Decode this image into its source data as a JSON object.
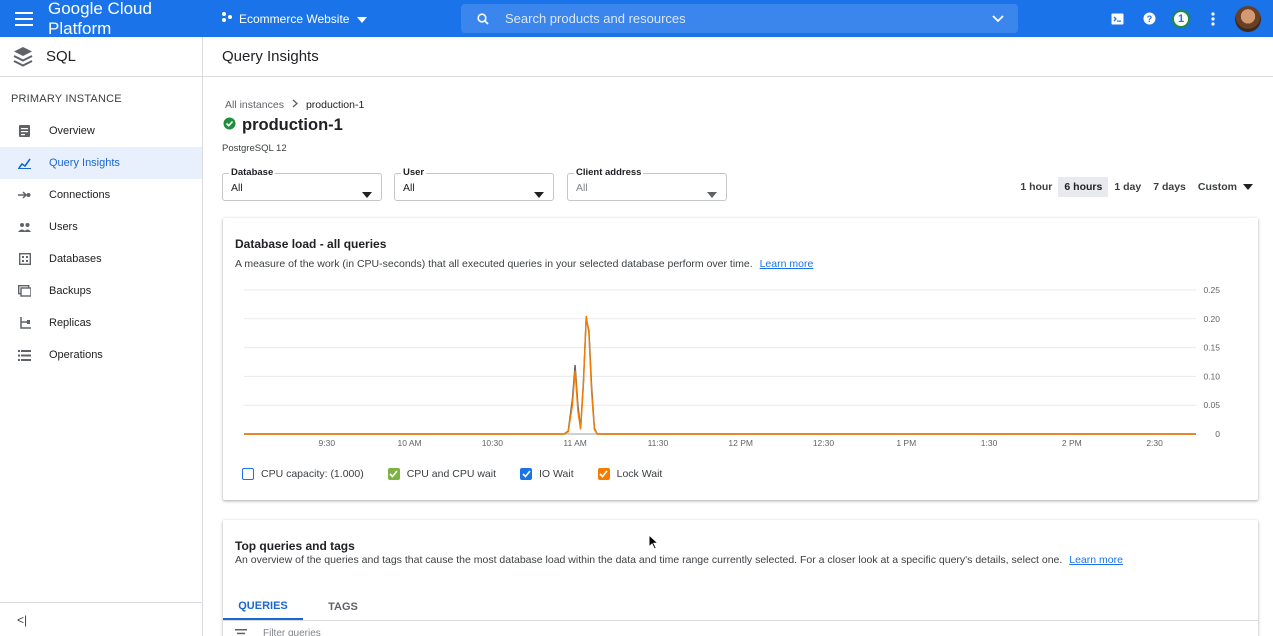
{
  "topbar": {
    "brand": "Google Cloud Platform",
    "project": "Ecommerce Website",
    "search_placeholder": "Search products and resources",
    "notification_count": "1",
    "color": "#1a73e8"
  },
  "sidebar": {
    "product": "SQL",
    "section": "PRIMARY INSTANCE",
    "items": [
      {
        "label": "Overview",
        "icon": "overview-icon"
      },
      {
        "label": "Query Insights",
        "icon": "query-insights-icon",
        "active": true
      },
      {
        "label": "Connections",
        "icon": "connections-icon"
      },
      {
        "label": "Users",
        "icon": "users-icon"
      },
      {
        "label": "Databases",
        "icon": "databases-icon"
      },
      {
        "label": "Backups",
        "icon": "backups-icon"
      },
      {
        "label": "Replicas",
        "icon": "replicas-icon"
      },
      {
        "label": "Operations",
        "icon": "operations-icon"
      }
    ],
    "collapse_label": "<|"
  },
  "main": {
    "page_title": "Query Insights",
    "breadcrumb": {
      "parent": "All instances",
      "current": "production-1"
    },
    "instance_name": "production-1",
    "instance_version": "PostgreSQL 12",
    "filters": [
      {
        "label": "Database",
        "value": "All"
      },
      {
        "label": "User",
        "value": "All"
      },
      {
        "label": "Client address",
        "value": "All"
      }
    ],
    "time_range": {
      "options": [
        "1 hour",
        "6 hours",
        "1 day",
        "7 days"
      ],
      "selected": "6 hours",
      "custom": "Custom"
    }
  },
  "load_card": {
    "title": "Database load - all queries",
    "description": "A measure of the work (in CPU-seconds) that all executed queries in your selected database perform over time.",
    "learn_more": "Learn more",
    "legend": [
      {
        "label": "CPU capacity: (1.000)",
        "color": "#1a73e8",
        "checked": false
      },
      {
        "label": "CPU and CPU wait",
        "color": "#7cb342",
        "checked": true
      },
      {
        "label": "IO Wait",
        "color": "#1a73e8",
        "checked": true
      },
      {
        "label": "Lock Wait",
        "color": "#f57c00",
        "checked": true
      }
    ]
  },
  "chart_data": {
    "type": "line",
    "x_ticks": [
      "9:30",
      "10 AM",
      "10:30",
      "11 AM",
      "11:30",
      "12 PM",
      "12:30",
      "1 PM",
      "1:30",
      "2 PM",
      "2:30"
    ],
    "y_ticks": [
      "0.25",
      "0.20",
      "0.15",
      "0.10",
      "0.05",
      "0"
    ],
    "ylim": [
      0,
      0.25
    ],
    "grid": true,
    "x_domain_minutes": [
      540,
      885
    ],
    "series": [
      {
        "name": "IO Wait",
        "color": "#5f6368",
        "points": [
          [
            540,
            0
          ],
          [
            656,
            0
          ],
          [
            657.5,
            0.005
          ],
          [
            659,
            0.06
          ],
          [
            660,
            0.12
          ],
          [
            661,
            0.05
          ],
          [
            662,
            0.01
          ],
          [
            663,
            0.09
          ],
          [
            664,
            0.2
          ],
          [
            665,
            0.18
          ],
          [
            666,
            0.08
          ],
          [
            667,
            0.01
          ],
          [
            668,
            0
          ],
          [
            885,
            0
          ]
        ]
      },
      {
        "name": "Lock Wait",
        "color": "#f57c00",
        "points": [
          [
            540,
            0
          ],
          [
            656,
            0
          ],
          [
            657.5,
            0.004
          ],
          [
            659,
            0.05
          ],
          [
            660,
            0.11
          ],
          [
            661,
            0.04
          ],
          [
            662,
            0.008
          ],
          [
            663,
            0.085
          ],
          [
            664,
            0.205
          ],
          [
            665,
            0.175
          ],
          [
            666,
            0.07
          ],
          [
            667,
            0.008
          ],
          [
            668,
            0
          ],
          [
            885,
            0
          ]
        ]
      }
    ]
  },
  "queries_card": {
    "title": "Top queries and tags",
    "description": "An overview of the queries and tags that cause the most database load within the data and time range currently selected. For a closer look at a specific query's details, select one.",
    "learn_more": "Learn more",
    "tabs": [
      "QUERIES",
      "TAGS"
    ],
    "filter_placeholder": "Filter queries"
  }
}
